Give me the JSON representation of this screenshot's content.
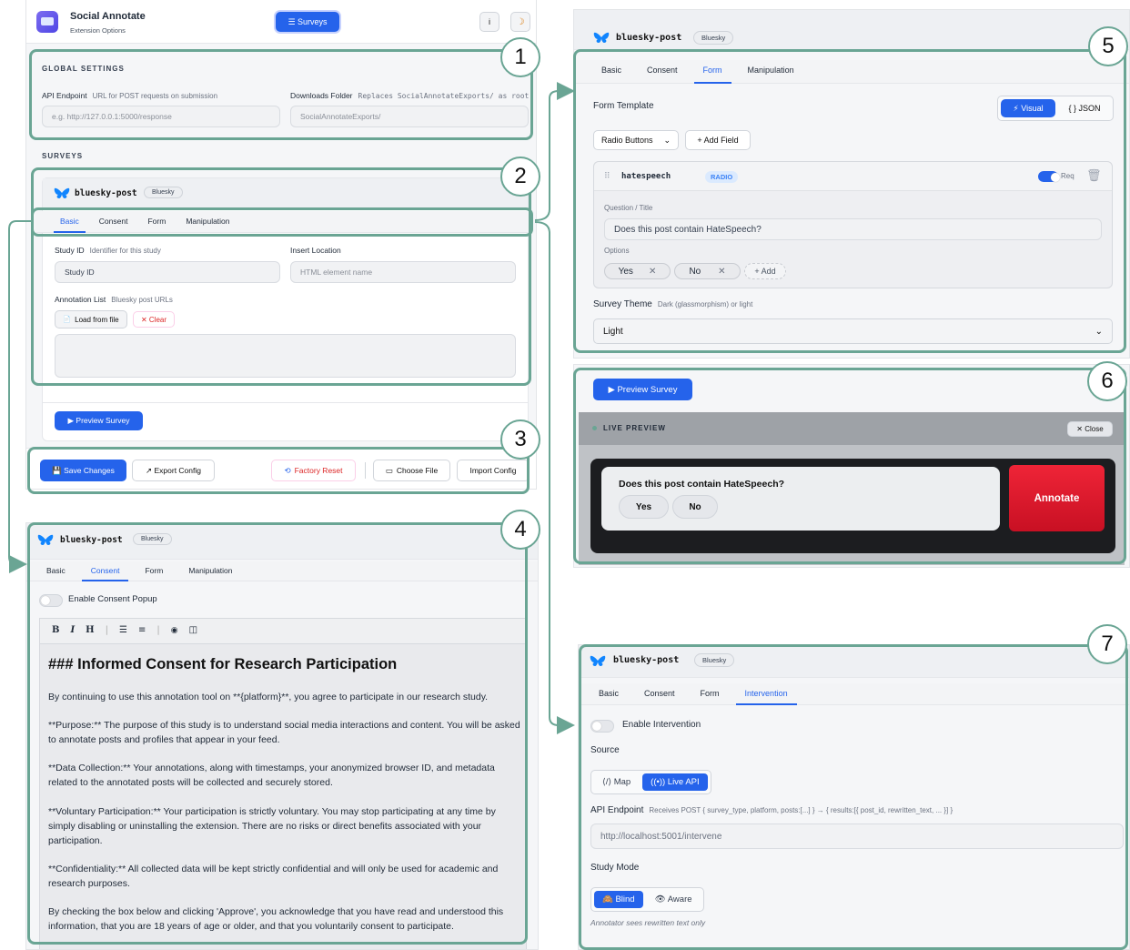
{
  "header": {
    "app_name": "Social Annotate",
    "app_sub": "Extension Options",
    "surveys_btn": "☰ Surveys",
    "info": "i",
    "theme": "☽"
  },
  "global": {
    "section": "GLOBAL SETTINGS",
    "api_label": "API Endpoint",
    "api_hint": "URL for POST requests on submission",
    "api_placeholder": "e.g. http://127.0.0.1:5000/response",
    "dl_label": "Downloads Folder",
    "dl_hint": "Replaces SocialAnnotateExports/ as root",
    "dl_placeholder": "SocialAnnotateExports/"
  },
  "surveys": {
    "section": "SURVEYS",
    "post_name": "bluesky-post",
    "platform": "Bluesky",
    "tabs": [
      "Basic",
      "Consent",
      "Form",
      "Manipulation"
    ],
    "study_label": "Study ID",
    "study_hint": "Identifier for this study",
    "study_placeholder": "Study ID",
    "insert_label": "Insert Location",
    "insert_placeholder": "HTML element name",
    "list_label": "Annotation List",
    "list_hint": "Bluesky post URLs",
    "load_btn": "Load from file",
    "clear_btn": "✕ Clear",
    "preview_btn": "▶ Preview Survey"
  },
  "actions": {
    "save": "💾 Save Changes",
    "export": "↗ Export Config",
    "reset": "Factory Reset",
    "choose": "Choose File",
    "import": "Import Config"
  },
  "consent": {
    "tabs": [
      "Basic",
      "Consent",
      "Form",
      "Manipulation"
    ],
    "enable": "Enable Consent Popup",
    "toolbar": [
      "B",
      "I",
      "H",
      "☰",
      "≡",
      "◉",
      "◫"
    ],
    "heading": "### Informed Consent for Research Participation",
    "p1": "By continuing to use this annotation tool on **{platform}**, you agree to participate in our research study.",
    "p2": "**Purpose:** The purpose of this study is to understand social media interactions and content. You will be asked to annotate posts and profiles that appear in your feed.",
    "p3": "**Data Collection:** Your annotations, along with timestamps, your anonymized browser ID, and metadata related to the annotated posts will be collected and securely stored.",
    "p4": "**Voluntary Participation:** Your participation is strictly voluntary. You may stop participating at any time by simply disabling or uninstalling the extension. There are no risks or direct benefits associated with your participation.",
    "p5": "**Confidentiality:** All collected data will be kept strictly confidential and will only be used for academic and research purposes.",
    "p6": "By checking the box below and clicking 'Approve', you acknowledge that you have read and understood this information, that you are 18 years of age or older, and that you voluntarily consent to participate."
  },
  "form": {
    "tabs": [
      "Basic",
      "Consent",
      "Form",
      "Manipulation"
    ],
    "template_label": "Form Template",
    "visual": "⚡ Visual",
    "json": "{ } JSON",
    "type_select": "Radio Buttons",
    "add_field": "+ Add Field",
    "field_name": "hatespeech",
    "field_type": "RADIO",
    "req": "Req",
    "question_label": "Question / Title",
    "question": "Does this post contain HateSpeech?",
    "options_label": "Options",
    "opt1": "Yes",
    "opt2": "No",
    "add_opt": "+ Add",
    "theme_label": "Survey Theme",
    "theme_hint": "Dark (glassmorphism) or light",
    "theme_value": "Light"
  },
  "preview": {
    "btn": "▶ Preview Survey",
    "live": "LIVE PREVIEW",
    "close": "✕ Close",
    "question": "Does this post contain HateSpeech?",
    "yes": "Yes",
    "no": "No",
    "annotate": "Annotate"
  },
  "intervention": {
    "tabs": [
      "Basic",
      "Consent",
      "Form",
      "Intervention"
    ],
    "enable": "Enable Intervention",
    "source_label": "Source",
    "map": "⟨/⟩ Map",
    "live_api": "((•)) Live API",
    "api_label": "API Endpoint",
    "api_hint": "Receives POST { survey_type, platform, posts:[...] } → { results:[{ post_id, rewritten_text, ... }] }",
    "api_value": "http://localhost:5001/intervene",
    "mode_label": "Study Mode",
    "blind": "🙈 Blind",
    "aware": "👁 Aware",
    "mode_hint": "Annotator sees rewritten text only"
  },
  "callouts": [
    "1",
    "2",
    "3",
    "4",
    "5",
    "6",
    "7"
  ],
  "colors": {
    "frame": "#6aa594",
    "primary": "#2563eb",
    "annotate": "#e11d2e"
  }
}
